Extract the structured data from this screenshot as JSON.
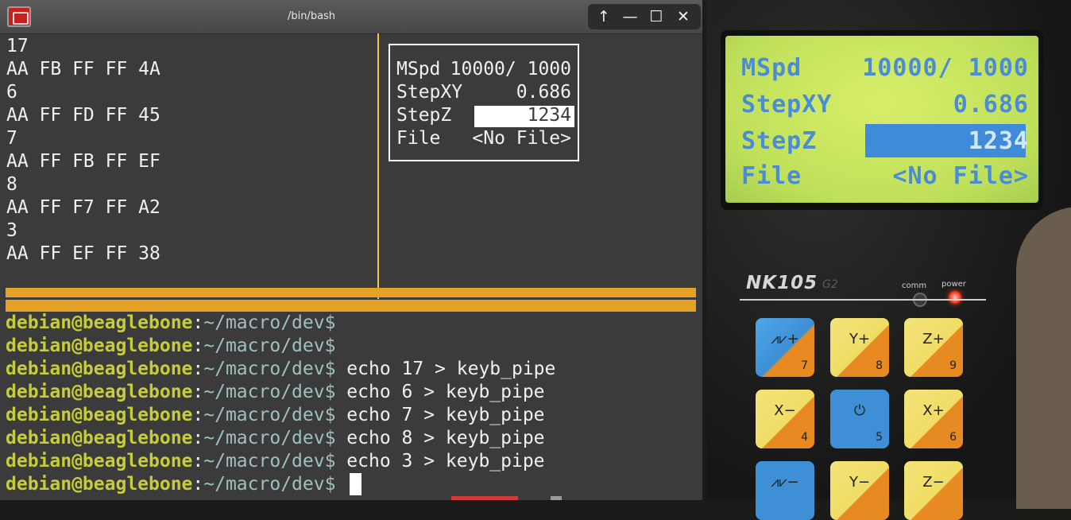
{
  "window": {
    "title": "/bin/bash",
    "buttons": {
      "up": "↑",
      "minimize": "—",
      "maximize": "☐",
      "close": "✕"
    }
  },
  "left_output": [
    "17",
    "AA FB FF FF 4A",
    "6",
    "AA FF FD FF 45",
    "7",
    "AA FF FB FF EF",
    "8",
    "AA FF F7 FF A2",
    "3",
    "AA FF EF FF 38"
  ],
  "lcd_sim": {
    "rows": [
      {
        "label": "MSpd",
        "value": "10000/ 1000"
      },
      {
        "label": "StepXY",
        "value": "0.686"
      },
      {
        "label": "StepZ",
        "value": "1234",
        "selected": true
      },
      {
        "label": "File",
        "value": "<No File>"
      }
    ]
  },
  "shell": {
    "user_host": "debian@beaglebone",
    "colon": ":",
    "path": "~/macro/dev$",
    "lines": [
      {
        "cmd": ""
      },
      {
        "cmd": ""
      },
      {
        "cmd": " echo 17 > keyb_pipe"
      },
      {
        "cmd": " echo 6 > keyb_pipe"
      },
      {
        "cmd": " echo 7 > keyb_pipe"
      },
      {
        "cmd": " echo 8 > keyb_pipe"
      },
      {
        "cmd": " echo 3 > keyb_pipe"
      },
      {
        "cmd": " "
      }
    ]
  },
  "photo": {
    "screen_rows": [
      {
        "label": "MSpd",
        "value": "10000/ 1000"
      },
      {
        "label": "StepXY",
        "value": "0.686"
      },
      {
        "label": "StepZ",
        "value": "1234"
      },
      {
        "label": "File",
        "value": "<No File>"
      }
    ],
    "brand": "NK105",
    "brand_sub": "G2",
    "comm_label": "comm",
    "power_label": "power",
    "keys": [
      {
        "label": "⩘⩗+",
        "num": "7"
      },
      {
        "label": "Y+",
        "num": "8"
      },
      {
        "label": "Z+",
        "num": "9"
      },
      {
        "label": "X−",
        "num": "4"
      },
      {
        "label": "⏻",
        "num": "5"
      },
      {
        "label": "X+",
        "num": "6"
      },
      {
        "label": "⩘⩗−",
        "num": ""
      },
      {
        "label": "Y−",
        "num": ""
      },
      {
        "label": "Z−",
        "num": ""
      }
    ]
  },
  "colors": {
    "prompt_user": "#c7cc3a",
    "prompt_path": "#9fc0c0",
    "status_bar": "#e6a226",
    "divider": "#e9c84a",
    "lcd_text": "#4a8cd6"
  }
}
